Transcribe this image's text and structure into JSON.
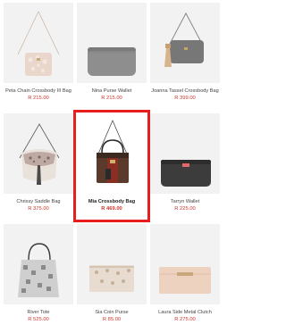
{
  "products": [
    {
      "name": "Peta Chain Crossbody III Bag",
      "price": "R 215.00",
      "icon": "crossbody-bag-pink-icon"
    },
    {
      "name": "Nina Purse Wallet",
      "price": "R 215.00",
      "icon": "grey-wallet-icon"
    },
    {
      "name": "Joanna Tassel Crossbody Bag",
      "price": "R 399.00",
      "icon": "tassel-crossbody-bag-icon"
    },
    {
      "name": "Chrissy Saddle Bag",
      "price": "R 375.00",
      "icon": "saddle-bag-icon"
    },
    {
      "name": "Mia Crossbody Bag",
      "price": "R 469.00",
      "icon": "mia-crossbody-bag-icon"
    },
    {
      "name": "Tarryn Wallet",
      "price": "R 225.00",
      "icon": "black-wallet-icon"
    },
    {
      "name": "River Tote",
      "price": "R 525.00",
      "icon": "tote-bag-icon"
    },
    {
      "name": "Sia Coin Purse",
      "price": "R 85.00",
      "icon": "coin-purse-icon"
    },
    {
      "name": "Laura Side Metal Clutch",
      "price": "R 275.00",
      "icon": "clutch-icon"
    }
  ],
  "selected_product": "Mia Crossbody Bag",
  "colors": {
    "price": "#d0342c",
    "selection_outline": "#e81d1d",
    "tile_background": "#f2f2f2"
  }
}
